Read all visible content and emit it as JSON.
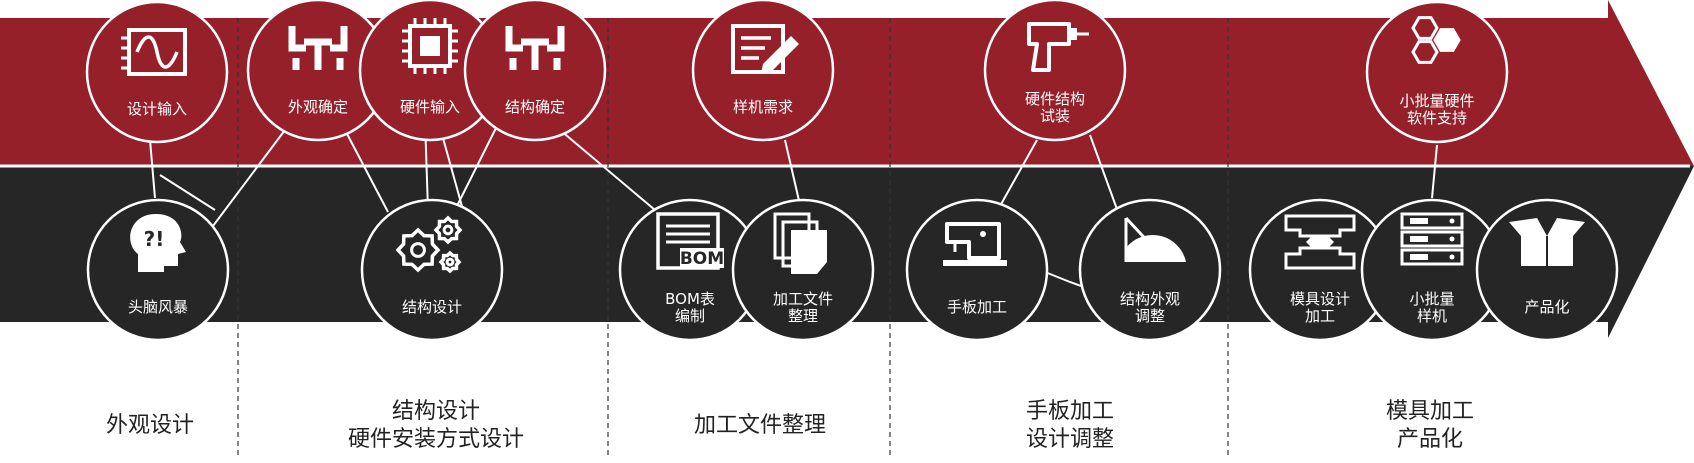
{
  "colors": {
    "red": "#96202a",
    "dark": "#262626",
    "white": "#ffffff",
    "text": "#222222"
  },
  "top_nodes": [
    {
      "id": "design-input",
      "icon": "sine-wave-chip-icon",
      "label": [
        "设计输入"
      ]
    },
    {
      "id": "appearance-confirm",
      "icon": "pipes-structure-icon",
      "label": [
        "外观确定"
      ]
    },
    {
      "id": "hardware-input",
      "icon": "cpu-chip-icon",
      "label": [
        "硬件输入"
      ]
    },
    {
      "id": "structure-confirm",
      "icon": "pipes-structure-icon",
      "label": [
        "结构确定"
      ]
    },
    {
      "id": "sample-demand",
      "icon": "document-edit-icon",
      "label": [
        "样机需求"
      ]
    },
    {
      "id": "hw-structure-trial",
      "icon": "power-drill-icon",
      "label": [
        "硬件结构",
        "试装"
      ]
    },
    {
      "id": "small-batch-support",
      "icon": "hexagons-icon",
      "label": [
        "小批量硬件",
        "软件支持"
      ]
    }
  ],
  "bottom_nodes": [
    {
      "id": "brainstorm",
      "icon": "head-question-icon",
      "label": [
        "头脑风暴"
      ]
    },
    {
      "id": "structure-design",
      "icon": "gears-icon",
      "label": [
        "结构设计"
      ]
    },
    {
      "id": "bom",
      "icon": "bom-document-icon",
      "label": [
        "BOM表",
        "编制"
      ],
      "icon_text": "BOM"
    },
    {
      "id": "processing-files",
      "icon": "file-stack-icon",
      "label": [
        "加工文件",
        "整理"
      ]
    },
    {
      "id": "manual-processing",
      "icon": "sewing-machine-icon",
      "label": [
        "手板加工"
      ]
    },
    {
      "id": "appearance-adjust",
      "icon": "protractor-icon",
      "label": [
        "结构外观",
        "调整"
      ]
    },
    {
      "id": "mold-processing",
      "icon": "mold-icon",
      "label": [
        "模具设计",
        "加工"
      ]
    },
    {
      "id": "small-batch-prototype",
      "icon": "server-rack-icon",
      "label": [
        "小批量",
        "样机"
      ]
    },
    {
      "id": "productization",
      "icon": "open-box-icon",
      "label": [
        "产品化"
      ]
    }
  ],
  "stages": [
    {
      "id": "appearance-design",
      "lines": [
        "外观设计"
      ]
    },
    {
      "id": "structure-hw",
      "lines": [
        "结构设计",
        "硬件安装方式设计"
      ]
    },
    {
      "id": "file-organize",
      "lines": [
        "加工文件整理"
      ]
    },
    {
      "id": "manual-adjust",
      "lines": [
        "手板加工",
        "设计调整"
      ]
    },
    {
      "id": "mold-product",
      "lines": [
        "模具加工",
        "产品化"
      ]
    }
  ]
}
